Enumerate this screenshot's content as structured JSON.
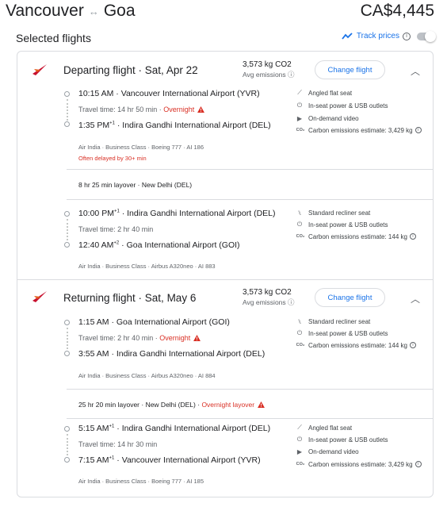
{
  "header": {
    "origin": "Vancouver",
    "destination": "Goa",
    "swap_icon": "↔",
    "price": "CA$4,445"
  },
  "selected": {
    "title": "Selected flights",
    "track_label": "Track prices"
  },
  "departing": {
    "title": "Departing flight · Sat, Apr 22",
    "co2": "3,573 kg CO2",
    "co2_sub": "Avg emissions",
    "change_label": "Change flight",
    "leg1": {
      "depart_time": "10:15 AM",
      "depart_airport": "Vancouver International Airport (YVR)",
      "travel": "Travel time: 14 hr 50 min ·",
      "overnight": "Overnight",
      "arrive_time": "1:35 PM",
      "arrive_sup": "+1",
      "arrive_airport": "Indira Gandhi International Airport (DEL)",
      "meta": "Air India · Business Class · Boeing 777 · AI 186",
      "delayed": "Often delayed by 30+ min",
      "amenities": [
        {
          "icon": "angled-seat-icon",
          "label": "Angled flat seat"
        },
        {
          "icon": "power-plug-icon",
          "label": "In-seat power & USB outlets"
        },
        {
          "icon": "video-icon",
          "label": "On-demand video"
        },
        {
          "icon": "co2-icon",
          "label": "Carbon emissions estimate: 3,429 kg"
        }
      ]
    },
    "layover": "8 hr 25 min layover · New Delhi (DEL)",
    "leg2": {
      "depart_time": "10:00 PM",
      "depart_sup": "+1",
      "depart_airport": "Indira Gandhi International Airport (DEL)",
      "travel": "Travel time: 2 hr 40 min",
      "arrive_time": "12:40 AM",
      "arrive_sup": "+2",
      "arrive_airport": "Goa International Airport (GOI)",
      "meta": "Air India · Business Class · Airbus A320neo · AI 883",
      "amenities": [
        {
          "icon": "recliner-seat-icon",
          "label": "Standard recliner seat"
        },
        {
          "icon": "power-plug-icon",
          "label": "In-seat power & USB outlets"
        },
        {
          "icon": "co2-icon",
          "label": "Carbon emissions estimate: 144 kg"
        }
      ]
    }
  },
  "returning": {
    "title": "Returning flight · Sat, May 6",
    "co2": "3,573 kg CO2",
    "co2_sub": "Avg emissions",
    "change_label": "Change flight",
    "leg1": {
      "depart_time": "1:15 AM",
      "depart_airport": "Goa International Airport (GOI)",
      "travel": "Travel time: 2 hr 40 min ·",
      "overnight": "Overnight",
      "arrive_time": "3:55 AM",
      "arrive_airport": "Indira Gandhi International Airport (DEL)",
      "meta": "Air India · Business Class · Airbus A320neo · AI 884",
      "amenities": [
        {
          "icon": "recliner-seat-icon",
          "label": "Standard recliner seat"
        },
        {
          "icon": "power-plug-icon",
          "label": "In-seat power & USB outlets"
        },
        {
          "icon": "co2-icon",
          "label": "Carbon emissions estimate: 144 kg"
        }
      ]
    },
    "layover": "25 hr 20 min layover · New Delhi (DEL) ·",
    "layover_overnight": "Overnight layover",
    "leg2": {
      "depart_time": "5:15 AM",
      "depart_sup": "+1",
      "depart_airport": "Indira Gandhi International Airport (DEL)",
      "travel": "Travel time: 14 hr 30 min",
      "arrive_time": "7:15 AM",
      "arrive_sup": "+1",
      "arrive_airport": "Vancouver International Airport (YVR)",
      "meta": "Air India · Business Class · Boeing 777 · AI 185",
      "amenities": [
        {
          "icon": "angled-seat-icon",
          "label": "Angled flat seat"
        },
        {
          "icon": "power-plug-icon",
          "label": "In-seat power & USB outlets"
        },
        {
          "icon": "video-icon",
          "label": "On-demand video"
        },
        {
          "icon": "co2-icon",
          "label": "Carbon emissions estimate: 3,429 kg"
        }
      ]
    }
  },
  "colors": {
    "accent": "#1a73e8",
    "warning": "#d93025",
    "airline_logo": "#c8102e"
  }
}
